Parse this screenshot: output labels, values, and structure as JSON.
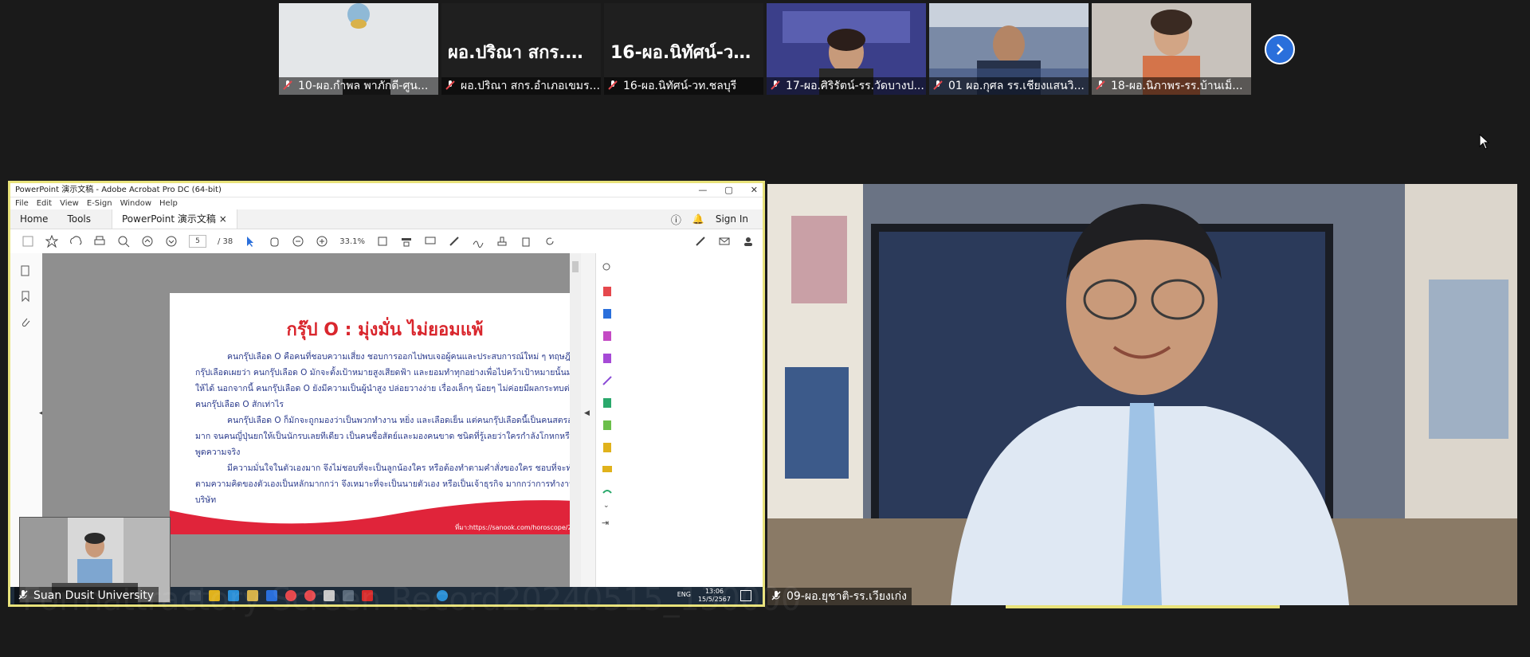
{
  "participants": [
    {
      "caption": "10-ผอ.กำพล พาภักดี-ศูน...",
      "big_name": ""
    },
    {
      "caption": "ผอ.ปริณา สกร.อำเภอเขมร...",
      "big_name": "ผอ.ปริณา สกร.อำ..."
    },
    {
      "caption": "16-ผอ.นิทัศน์-วท.ชลบุรี",
      "big_name": "16-ผอ.นิทัศน์-วท..."
    },
    {
      "caption": "17-ผอ.ศิริรัตน์-รร.วัดบางป...",
      "big_name": ""
    },
    {
      "caption": "01 ผอ.กุศล รร.เชียงแสนวิ...",
      "big_name": ""
    },
    {
      "caption": "18-ผอ.นิภาพร-รร.บ้านเม็...",
      "big_name": ""
    }
  ],
  "share": {
    "window_title": "PowerPoint 演示文稿 - Adobe Acrobat Pro DC (64-bit)",
    "menu": [
      "File",
      "Edit",
      "View",
      "E-Sign",
      "Window",
      "Help"
    ],
    "tabs": {
      "home": "Home",
      "tools": "Tools",
      "doc": "PowerPoint 演示文稿"
    },
    "sign_in": "Sign In",
    "page_current": "5",
    "page_total": "/ 38",
    "zoom": "33.1%",
    "slide": {
      "title": "กรุ๊ป O : มุ่งมั่น ไม่ยอมแพ้",
      "para1": "คนกรุ๊ปเลือด O คือคนที่ชอบความเสี่ยง ชอบการออกไปพบเจอผู้คนและประสบการณ์ใหม่ ๆ ทฤษฎีกรุ๊ปเลือดเผยว่า คนกรุ๊ปเลือด O มักจะตั้งเป้าหมายสูงเสียดฟ้า และยอมทำทุกอย่างเพื่อไปคว้าเป้าหมายนั้นมาให้ได้ นอกจากนี้ คนกรุ๊ปเลือด O ยังมีความเป็นผู้นำสูง ปล่อยวางง่าย เรื่องเล็กๆ น้อยๆ ไม่ค่อยมีผลกระทบต่อคนกรุ๊ปเลือด O สักเท่าไร",
      "para2": "คนกรุ๊ปเลือด O ก็มักจะถูกมองว่าเป็นพวกทำงาน หยิ่ง และเลือดเย็น แต่คนกรุ๊ปเลือดนี้เป็นคนสตรองมาก จนคนญี่ปุ่นยกให้เป็นนักรบเลยทีเดียว เป็นคนซื่อสัตย์และมองคนขาด ชนิดที่รู้เลยว่าใครกำลังโกหกหรือพูดความจริง",
      "para3": "มีความมั่นใจในตัวเองมาก จึงไม่ชอบที่จะเป็นลูกน้องใคร หรือต้องทำตามคำสั่งของใคร ชอบที่จะทำตามความคิดของตัวเองเป็นหลักมากกว่า จึงเหมาะที่จะเป็นนายตัวเอง หรือเป็นเจ้าธุรกิจ มากกว่าการทำงานบริษัท",
      "source": "ที่มา:https://sanook.com/horoscope/260147"
    },
    "taskbar_lang": "ENG",
    "taskbar_time": "13:06",
    "taskbar_date": "15/5/2567"
  },
  "pip_caption": "Suan Dusit University",
  "speaker_caption": "09-ผอ.ยุชาติ-รร.เวียงเก่ง",
  "watermark": "Formattractory Screen Record20240515_130000"
}
